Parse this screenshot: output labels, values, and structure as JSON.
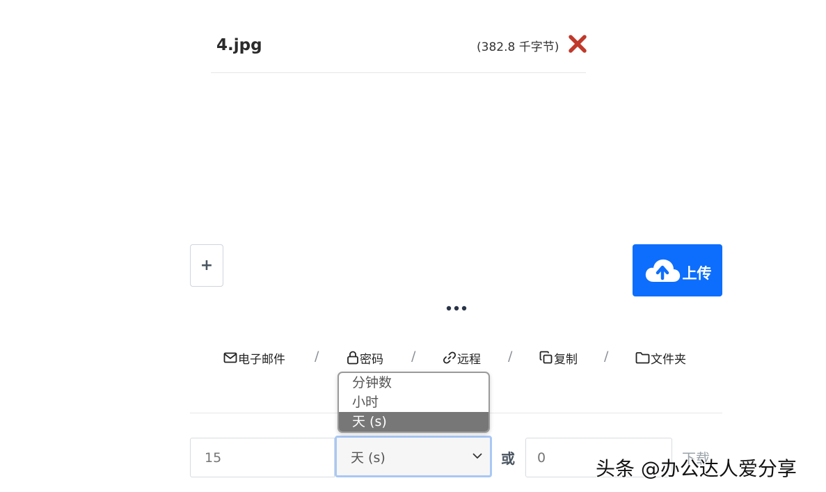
{
  "file": {
    "name": "4.jpg",
    "size": "(382.8 千字节)",
    "remove_icon": "close-x-icon",
    "remove_color": "#c0392b"
  },
  "actions": {
    "add_label": "+",
    "upload_label": "上传",
    "upload_icon": "cloud-upload-icon",
    "upload_color": "#0d6efd",
    "more_icon": "ellipsis-icon"
  },
  "options": [
    {
      "icon": "envelope-icon",
      "label": "电子邮件"
    },
    {
      "icon": "lock-icon",
      "label": "密码"
    },
    {
      "icon": "link-icon",
      "label": "远程"
    },
    {
      "icon": "copy-icon",
      "label": "复制"
    },
    {
      "icon": "folder-icon",
      "label": "文件夹"
    }
  ],
  "separator": "/",
  "form": {
    "expiry_placeholder": "15",
    "unit_selected": "天 (s)",
    "or_label": "或",
    "downloads_placeholder": "0",
    "downloads_label": "下载"
  },
  "dropdown": {
    "options": [
      "分钟数",
      "小时",
      "天 (s)"
    ],
    "selected_index": 2
  },
  "watermark": "头条 @办公达人爱分享"
}
